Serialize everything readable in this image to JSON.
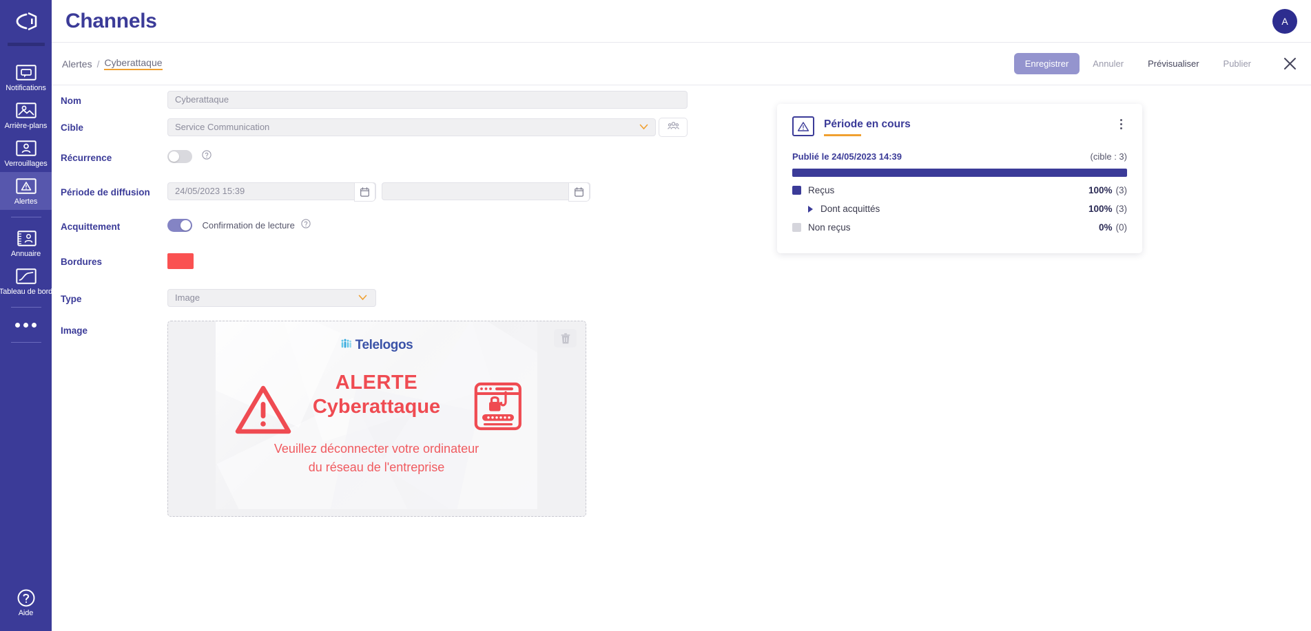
{
  "sidebar": {
    "logo": "brand-logo",
    "items": [
      {
        "label": "Notifications",
        "icon": "notification-icon",
        "active": false
      },
      {
        "label": "Arrière-plans",
        "icon": "background-image-icon",
        "active": false
      },
      {
        "label": "Verrouillages",
        "icon": "lock-user-icon",
        "active": false
      },
      {
        "label": "Alertes",
        "icon": "alert-triangle-icon",
        "active": true
      },
      {
        "label": "Annuaire",
        "icon": "address-book-icon",
        "active": false
      },
      {
        "label": "Tableau de bord",
        "icon": "dashboard-chart-icon",
        "active": false
      }
    ],
    "more": "more-dots-icon",
    "help": {
      "label": "Aide",
      "icon": "help-circle-icon"
    }
  },
  "header": {
    "title": "Channels",
    "avatar_initial": "A"
  },
  "breadcrumb": {
    "root": "Alertes",
    "separator": "/",
    "current": "Cyberattaque"
  },
  "toolbar": {
    "save_label": "Enregistrer",
    "cancel_label": "Annuler",
    "preview_label": "Prévisualiser",
    "publish_label": "Publier",
    "close_icon": "close-icon"
  },
  "form": {
    "nom": {
      "label": "Nom",
      "value": "Cyberattaque"
    },
    "cible": {
      "label": "Cible",
      "value": "Service Communication",
      "picker_icon": "group-people-icon"
    },
    "recurrence": {
      "label": "Récurrence",
      "enabled": false,
      "help_icon": "help-circle-icon"
    },
    "periode": {
      "label": "Période de diffusion",
      "start": "24/05/2023 15:39",
      "end": "",
      "calendar_icon": "calendar-icon"
    },
    "acquittement": {
      "label": "Acquittement",
      "enabled": true,
      "option_label": "Confirmation de lecture",
      "help_icon": "help-circle-icon"
    },
    "bordures": {
      "label": "Bordures",
      "color": "#fa5151"
    },
    "type": {
      "label": "Type",
      "value": "Image"
    },
    "image": {
      "label": "Image",
      "delete_icon": "trash-icon"
    }
  },
  "poster": {
    "logo_text": "Telelogos",
    "logo_mark": "people-group-icon",
    "title_line1": "ALERTE",
    "title_line2": "Cyberattaque",
    "message_line1": "Veuillez déconnecter votre ordinateur",
    "message_line2": "du réseau de l'entreprise",
    "warning_icon": "warning-triangle-icon",
    "phishing_icon": "phishing-browser-lock-icon",
    "accent_color": "#ef4b52"
  },
  "stats": {
    "icon": "alert-triangle-icon",
    "title": "Période en cours",
    "menu_icon": "kebab-menu-icon",
    "published_label": "Publié le 24/05/2023 14:39",
    "target_label": "(cible : 3)",
    "progress_percent": 100,
    "rows": [
      {
        "name": "Reçus",
        "percent": "100%",
        "count": "(3)",
        "swatch": "filled",
        "sub": false
      },
      {
        "name": "Dont acquittés",
        "percent": "100%",
        "count": "(3)",
        "swatch": "none",
        "sub": true
      },
      {
        "name": "Non reçus",
        "percent": "0%",
        "count": "(0)",
        "swatch": "empty",
        "sub": false
      }
    ]
  },
  "colors": {
    "brand_indigo": "#3b3b98",
    "accent_orange": "#f0a030",
    "alert_red": "#ef4b52"
  }
}
